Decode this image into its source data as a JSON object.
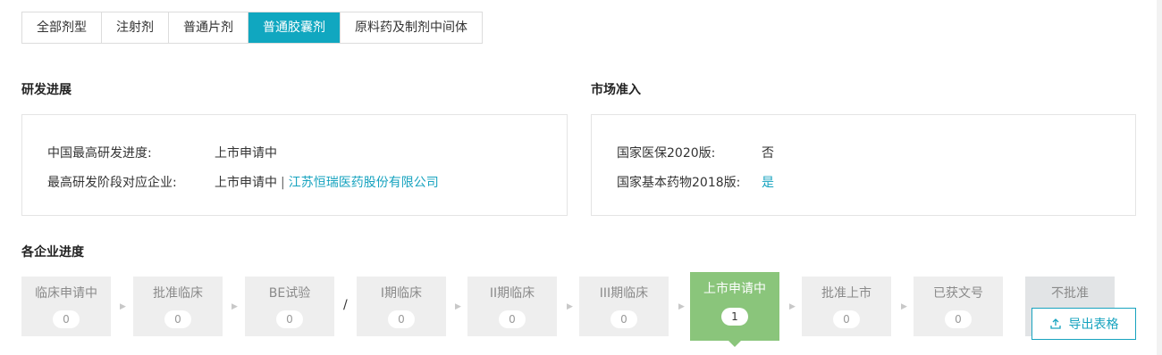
{
  "tabs": [
    {
      "label": "全部剂型",
      "active": false
    },
    {
      "label": "注射剂",
      "active": false
    },
    {
      "label": "普通片剂",
      "active": false
    },
    {
      "label": "普通胶囊剂",
      "active": true
    },
    {
      "label": "原料药及制剂中间体",
      "active": false
    }
  ],
  "rd": {
    "title": "研发进展",
    "highest_stage_label": "中国最高研发进度:",
    "highest_stage_value": "上市申请中",
    "company_label": "最高研发阶段对应企业:",
    "company_stage": "上市申请中",
    "separator": "|",
    "company_name": "江苏恒瑞医药股份有限公司"
  },
  "market": {
    "title": "市场准入",
    "insurance_label": "国家医保2020版:",
    "insurance_value": "否",
    "essential_label": "国家基本药物2018版:",
    "essential_value": "是"
  },
  "progress": {
    "title": "各企业进度",
    "slash": "/",
    "steps": [
      {
        "name": "临床申请中",
        "count": "0"
      },
      {
        "name": "批准临床",
        "count": "0"
      },
      {
        "name": "BE试验",
        "count": "0"
      },
      {
        "name": "I期临床",
        "count": "0"
      },
      {
        "name": "II期临床",
        "count": "0"
      },
      {
        "name": "III期临床",
        "count": "0"
      },
      {
        "name": "上市申请中",
        "count": "1",
        "active": true
      },
      {
        "name": "批准上市",
        "count": "0"
      },
      {
        "name": "已获文号",
        "count": "0"
      },
      {
        "name": "不批准",
        "count": ""
      }
    ]
  },
  "export_button": {
    "label": "导出表格",
    "icon": "upload-icon"
  },
  "colors": {
    "accent": "#10a7c0",
    "active_step": "#8ac57b",
    "link": "#17a3bf"
  }
}
